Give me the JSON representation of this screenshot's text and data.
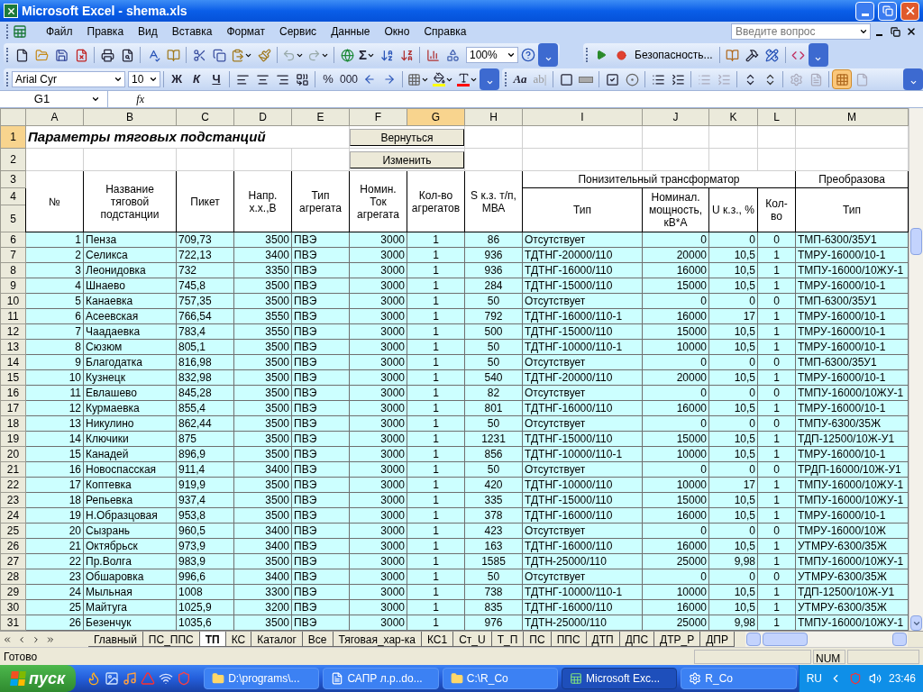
{
  "window": {
    "title": "Microsoft Excel - shema.xls"
  },
  "menu": [
    "Файл",
    "Правка",
    "Вид",
    "Вставка",
    "Формат",
    "Сервис",
    "Данные",
    "Окно",
    "Справка"
  ],
  "help_box": {
    "placeholder": "Введите вопрос"
  },
  "toolbar": {
    "sum": "Σ",
    "zoom": "100%",
    "security": "Безопасность...",
    "font": "Arial Cyr",
    "font_size": "10",
    "bold": "Ж",
    "italic": "К",
    "underline": "Ч",
    "percent": "%",
    "thousands": "000",
    "label_tool": "Aa",
    "edit_box_tool": "ab|",
    "grid_toggle": {
      "on": true
    }
  },
  "formula_bar": {
    "name_box": "G1",
    "fx": "fx"
  },
  "sheet": {
    "columns": [
      {
        "label": "A",
        "selected": false
      },
      {
        "label": "B",
        "selected": false
      },
      {
        "label": "C",
        "selected": false
      },
      {
        "label": "D",
        "selected": false
      },
      {
        "label": "E",
        "selected": false
      },
      {
        "label": "F",
        "selected": false
      },
      {
        "label": "G",
        "selected": true
      },
      {
        "label": "H",
        "selected": false
      },
      {
        "label": "I",
        "selected": false
      },
      {
        "label": "J",
        "selected": false
      },
      {
        "label": "K",
        "selected": false
      },
      {
        "label": "L",
        "selected": false
      },
      {
        "label": "M",
        "selected": false
      }
    ],
    "title": "Параметры тяговых подстанций",
    "buttons": [
      "Вернуться",
      "Изменить"
    ],
    "header": {
      "cols": [
        "№",
        "Название тяговой подстанции",
        "Пикет",
        "Напр. х.х.,В",
        "Тип агрегата",
        "Номин. Ток агрегата",
        "Кол-во агрегатов",
        "S к.з. т/п, МВА"
      ],
      "group": "Понизительный трансформатор",
      "group_cols": [
        "Тип",
        "Номинал. мощность, кВ*А",
        "U к.з., %",
        "Кол-во"
      ],
      "group2": "Преобразова",
      "group2_cols": [
        "Тип"
      ]
    },
    "row_headers": [
      {
        "label": "1",
        "selected": true
      },
      {
        "label": "2",
        "selected": false
      },
      {
        "label": "3",
        "selected": false
      },
      {
        "label": "4",
        "selected": false
      },
      {
        "label": "5",
        "selected": false
      }
    ],
    "rows": [
      {
        "n": "6",
        "cells": [
          "1",
          "Пенза",
          "709,73",
          "3500",
          "ПВЭ",
          "3000",
          "1",
          "86",
          "Отсутствует",
          "0",
          "0",
          "0",
          "ТМП-6300/35У1"
        ]
      },
      {
        "n": "7",
        "cells": [
          "2",
          "Селикса",
          "722,13",
          "3400",
          "ПВЭ",
          "3000",
          "1",
          "936",
          "ТДТНГ-20000/110",
          "20000",
          "10,5",
          "1",
          "ТМРУ-16000/10-1"
        ]
      },
      {
        "n": "8",
        "cells": [
          "3",
          "Леонидовка",
          "732",
          "3350",
          "ПВЭ",
          "3000",
          "1",
          "936",
          "ТДТНГ-16000/110",
          "16000",
          "10,5",
          "1",
          "ТМПУ-16000/10ЖУ-1"
        ]
      },
      {
        "n": "9",
        "cells": [
          "4",
          "Шнаево",
          "745,8",
          "3500",
          "ПВЭ",
          "3000",
          "1",
          "284",
          "ТДТНГ-15000/110",
          "15000",
          "10,5",
          "1",
          "ТМРУ-16000/10-1"
        ]
      },
      {
        "n": "10",
        "cells": [
          "5",
          "Канаевка",
          "757,35",
          "3500",
          "ПВЭ",
          "3000",
          "1",
          "50",
          "Отсутствует",
          "0",
          "0",
          "0",
          "ТМП-6300/35У1"
        ]
      },
      {
        "n": "11",
        "cells": [
          "6",
          "Асеевская",
          "766,54",
          "3550",
          "ПВЭ",
          "3000",
          "1",
          "792",
          "ТДТНГ-16000/110-1",
          "16000",
          "17",
          "1",
          "ТМРУ-16000/10-1"
        ]
      },
      {
        "n": "12",
        "cells": [
          "7",
          "Чаадаевка",
          "783,4",
          "3550",
          "ПВЭ",
          "3000",
          "1",
          "500",
          "ТДТНГ-15000/110",
          "15000",
          "10,5",
          "1",
          "ТМРУ-16000/10-1"
        ]
      },
      {
        "n": "13",
        "cells": [
          "8",
          "Сюзюм",
          "805,1",
          "3500",
          "ПВЭ",
          "3000",
          "1",
          "50",
          "ТДТНГ-10000/110-1",
          "10000",
          "10,5",
          "1",
          "ТМРУ-16000/10-1"
        ]
      },
      {
        "n": "14",
        "cells": [
          "9",
          "Благодатка",
          "816,98",
          "3500",
          "ПВЭ",
          "3000",
          "1",
          "50",
          "Отсутствует",
          "0",
          "0",
          "0",
          "ТМП-6300/35У1"
        ]
      },
      {
        "n": "15",
        "cells": [
          "10",
          "Кузнецк",
          "832,98",
          "3500",
          "ПВЭ",
          "3000",
          "1",
          "540",
          "ТДТНГ-20000/110",
          "20000",
          "10,5",
          "1",
          "ТМРУ-16000/10-1"
        ]
      },
      {
        "n": "16",
        "cells": [
          "11",
          "Евлашево",
          "845,28",
          "3500",
          "ПВЭ",
          "3000",
          "1",
          "82",
          "Отсутствует",
          "0",
          "0",
          "0",
          "ТМПУ-16000/10ЖУ-1"
        ]
      },
      {
        "n": "17",
        "cells": [
          "12",
          "Курмаевка",
          "855,4",
          "3500",
          "ПВЭ",
          "3000",
          "1",
          "801",
          "ТДТНГ-16000/110",
          "16000",
          "10,5",
          "1",
          "ТМРУ-16000/10-1"
        ]
      },
      {
        "n": "18",
        "cells": [
          "13",
          "Никулино",
          "862,44",
          "3500",
          "ПВЭ",
          "3000",
          "1",
          "50",
          "Отсутствует",
          "0",
          "0",
          "0",
          "ТМПУ-6300/35Ж"
        ]
      },
      {
        "n": "19",
        "cells": [
          "14",
          "Ключики",
          "875",
          "3500",
          "ПВЭ",
          "3000",
          "1",
          "1231",
          "ТДТНГ-15000/110",
          "15000",
          "10,5",
          "1",
          "ТДП-12500/10Ж-У1"
        ]
      },
      {
        "n": "20",
        "cells": [
          "15",
          "Канадей",
          "896,9",
          "3500",
          "ПВЭ",
          "3000",
          "1",
          "856",
          "ТДТНГ-10000/110-1",
          "10000",
          "10,5",
          "1",
          "ТМРУ-16000/10-1"
        ]
      },
      {
        "n": "21",
        "cells": [
          "16",
          "Новоспасская",
          "911,4",
          "3400",
          "ПВЭ",
          "3000",
          "1",
          "50",
          "Отсутствует",
          "0",
          "0",
          "0",
          "ТРДП-16000/10Ж-У1"
        ]
      },
      {
        "n": "22",
        "cells": [
          "17",
          "Коптевка",
          "919,9",
          "3500",
          "ПВЭ",
          "3000",
          "1",
          "420",
          "ТДТНГ-10000/110",
          "10000",
          "17",
          "1",
          "ТМПУ-16000/10ЖУ-1"
        ]
      },
      {
        "n": "23",
        "cells": [
          "18",
          "Репьевка",
          "937,4",
          "3500",
          "ПВЭ",
          "3000",
          "1",
          "335",
          "ТДТНГ-15000/110",
          "15000",
          "10,5",
          "1",
          "ТМПУ-16000/10ЖУ-1"
        ]
      },
      {
        "n": "24",
        "cells": [
          "19",
          "Н.Образцовая",
          "953,8",
          "3500",
          "ПВЭ",
          "3000",
          "1",
          "378",
          "ТДТНГ-16000/110",
          "16000",
          "10,5",
          "1",
          "ТМРУ-16000/10-1"
        ]
      },
      {
        "n": "25",
        "cells": [
          "20",
          "Сызрань",
          "960,5",
          "3400",
          "ПВЭ",
          "3000",
          "1",
          "423",
          "Отсутствует",
          "0",
          "0",
          "0",
          "ТМРУ-16000/10Ж"
        ]
      },
      {
        "n": "26",
        "cells": [
          "21",
          "Октябрьск",
          "973,9",
          "3400",
          "ПВЭ",
          "3000",
          "1",
          "163",
          "ТДТНГ-16000/110",
          "16000",
          "10,5",
          "1",
          "УТМРУ-6300/35Ж"
        ]
      },
      {
        "n": "27",
        "cells": [
          "22",
          "Пр.Волга",
          "983,9",
          "3500",
          "ПВЭ",
          "3000",
          "1",
          "1585",
          "ТДТН-25000/110",
          "25000",
          "9,98",
          "1",
          "ТМПУ-16000/10ЖУ-1"
        ]
      },
      {
        "n": "28",
        "cells": [
          "23",
          "Обшаровка",
          "996,6",
          "3400",
          "ПВЭ",
          "3000",
          "1",
          "50",
          "Отсутствует",
          "0",
          "0",
          "0",
          "УТМРУ-6300/35Ж"
        ]
      },
      {
        "n": "29",
        "cells": [
          "24",
          "Мыльная",
          "1008",
          "3300",
          "ПВЭ",
          "3000",
          "1",
          "738",
          "ТДТНГ-10000/110-1",
          "10000",
          "10,5",
          "1",
          "ТДП-12500/10Ж-У1"
        ]
      },
      {
        "n": "30",
        "cells": [
          "25",
          "Майтуга",
          "1025,9",
          "3200",
          "ПВЭ",
          "3000",
          "1",
          "835",
          "ТДТНГ-16000/110",
          "16000",
          "10,5",
          "1",
          "УТМРУ-6300/35Ж"
        ]
      },
      {
        "n": "31",
        "cells": [
          "26",
          "Безенчук",
          "1035,6",
          "3500",
          "ПВЭ",
          "3000",
          "1",
          "976",
          "ТДТН-25000/110",
          "25000",
          "9,98",
          "1",
          "ТМПУ-16000/10ЖУ-1"
        ]
      }
    ]
  },
  "sheet_tabs": [
    {
      "label": "Главный",
      "selected": false
    },
    {
      "label": "ПС_ППС",
      "selected": false
    },
    {
      "label": "ТП",
      "selected": true
    },
    {
      "label": "КС",
      "selected": false
    },
    {
      "label": "Каталог",
      "selected": false
    },
    {
      "label": "Все",
      "selected": false
    },
    {
      "label": "Тяговая_хар-ка",
      "selected": false
    },
    {
      "label": "КС1",
      "selected": false
    },
    {
      "label": "Ст_U",
      "selected": false
    },
    {
      "label": "Т_П",
      "selected": false
    },
    {
      "label": "ПС",
      "selected": false
    },
    {
      "label": "ППС",
      "selected": false
    },
    {
      "label": "ДТП",
      "selected": false
    },
    {
      "label": "ДПС",
      "selected": false
    },
    {
      "label": "ДТР_Р",
      "selected": false
    },
    {
      "label": "ДПР",
      "selected": false
    }
  ],
  "status_bar": {
    "status": "Готово",
    "num": "NUM"
  },
  "taskbar": {
    "start": "пуск",
    "tasks": [
      {
        "label": "D:\\programs\\...",
        "kind": "folder",
        "selected": false
      },
      {
        "label": "САПР л.р..do...",
        "kind": "word",
        "selected": false
      },
      {
        "label": "C:\\R_Co",
        "kind": "folder",
        "selected": false
      },
      {
        "label": "Microsoft Exc...",
        "kind": "excel",
        "selected": true
      },
      {
        "label": "R_Co",
        "kind": "gear",
        "selected": false
      }
    ],
    "language": "RU",
    "clock": "23:46"
  }
}
